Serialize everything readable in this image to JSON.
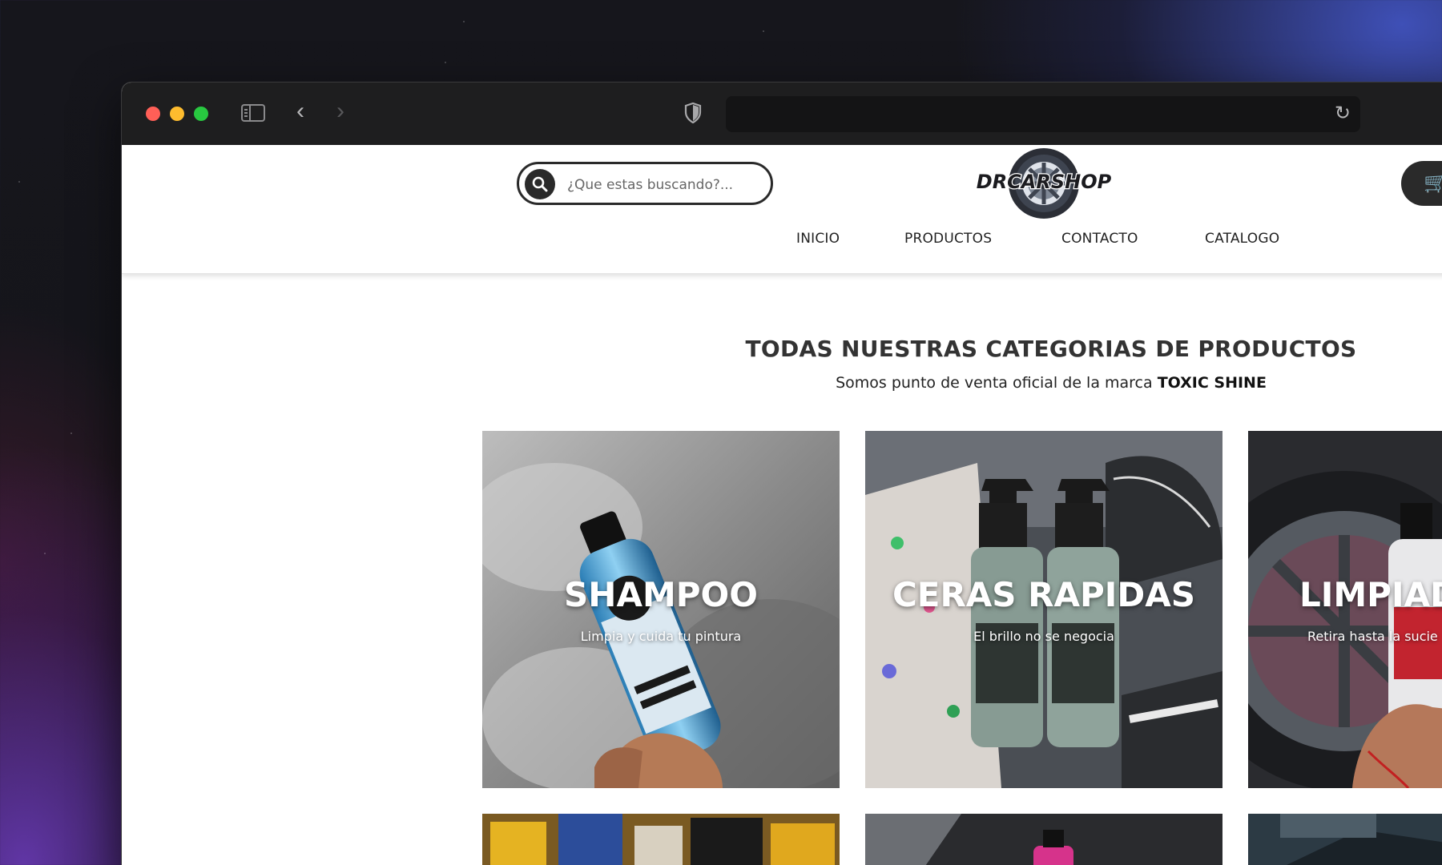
{
  "browser": {
    "url": ""
  },
  "site": {
    "logo_text": "DRCARSHOP",
    "search": {
      "placeholder": "¿Que estas buscando?..."
    },
    "nav": [
      {
        "label": "INICIO"
      },
      {
        "label": "PRODUCTOS"
      },
      {
        "label": "CONTACTO"
      },
      {
        "label": "CATALOGO"
      }
    ]
  },
  "main": {
    "title": "TODAS NUESTRAS CATEGORIAS DE PRODUCTOS",
    "subtitle_prefix": "Somos punto de venta oficial de la marca ",
    "subtitle_brand": "TOXIC SHINE",
    "categories": [
      {
        "title": "SHAMPOO",
        "subtitle": "Limpia y cuida tu pintura"
      },
      {
        "title": "CERAS RAPIDAS",
        "subtitle": "El brillo no se negocia"
      },
      {
        "title": "LIMPIAD",
        "subtitle": "Retira hasta la sucie"
      }
    ]
  },
  "colors": {
    "header_dark": "#2a2a2a",
    "titlebar": "#1e1e1f",
    "urlbar": "#141415"
  },
  "icons": {
    "search": "search-icon",
    "cart": "cart-icon",
    "shield": "shield-icon",
    "reload": "reload-icon"
  }
}
